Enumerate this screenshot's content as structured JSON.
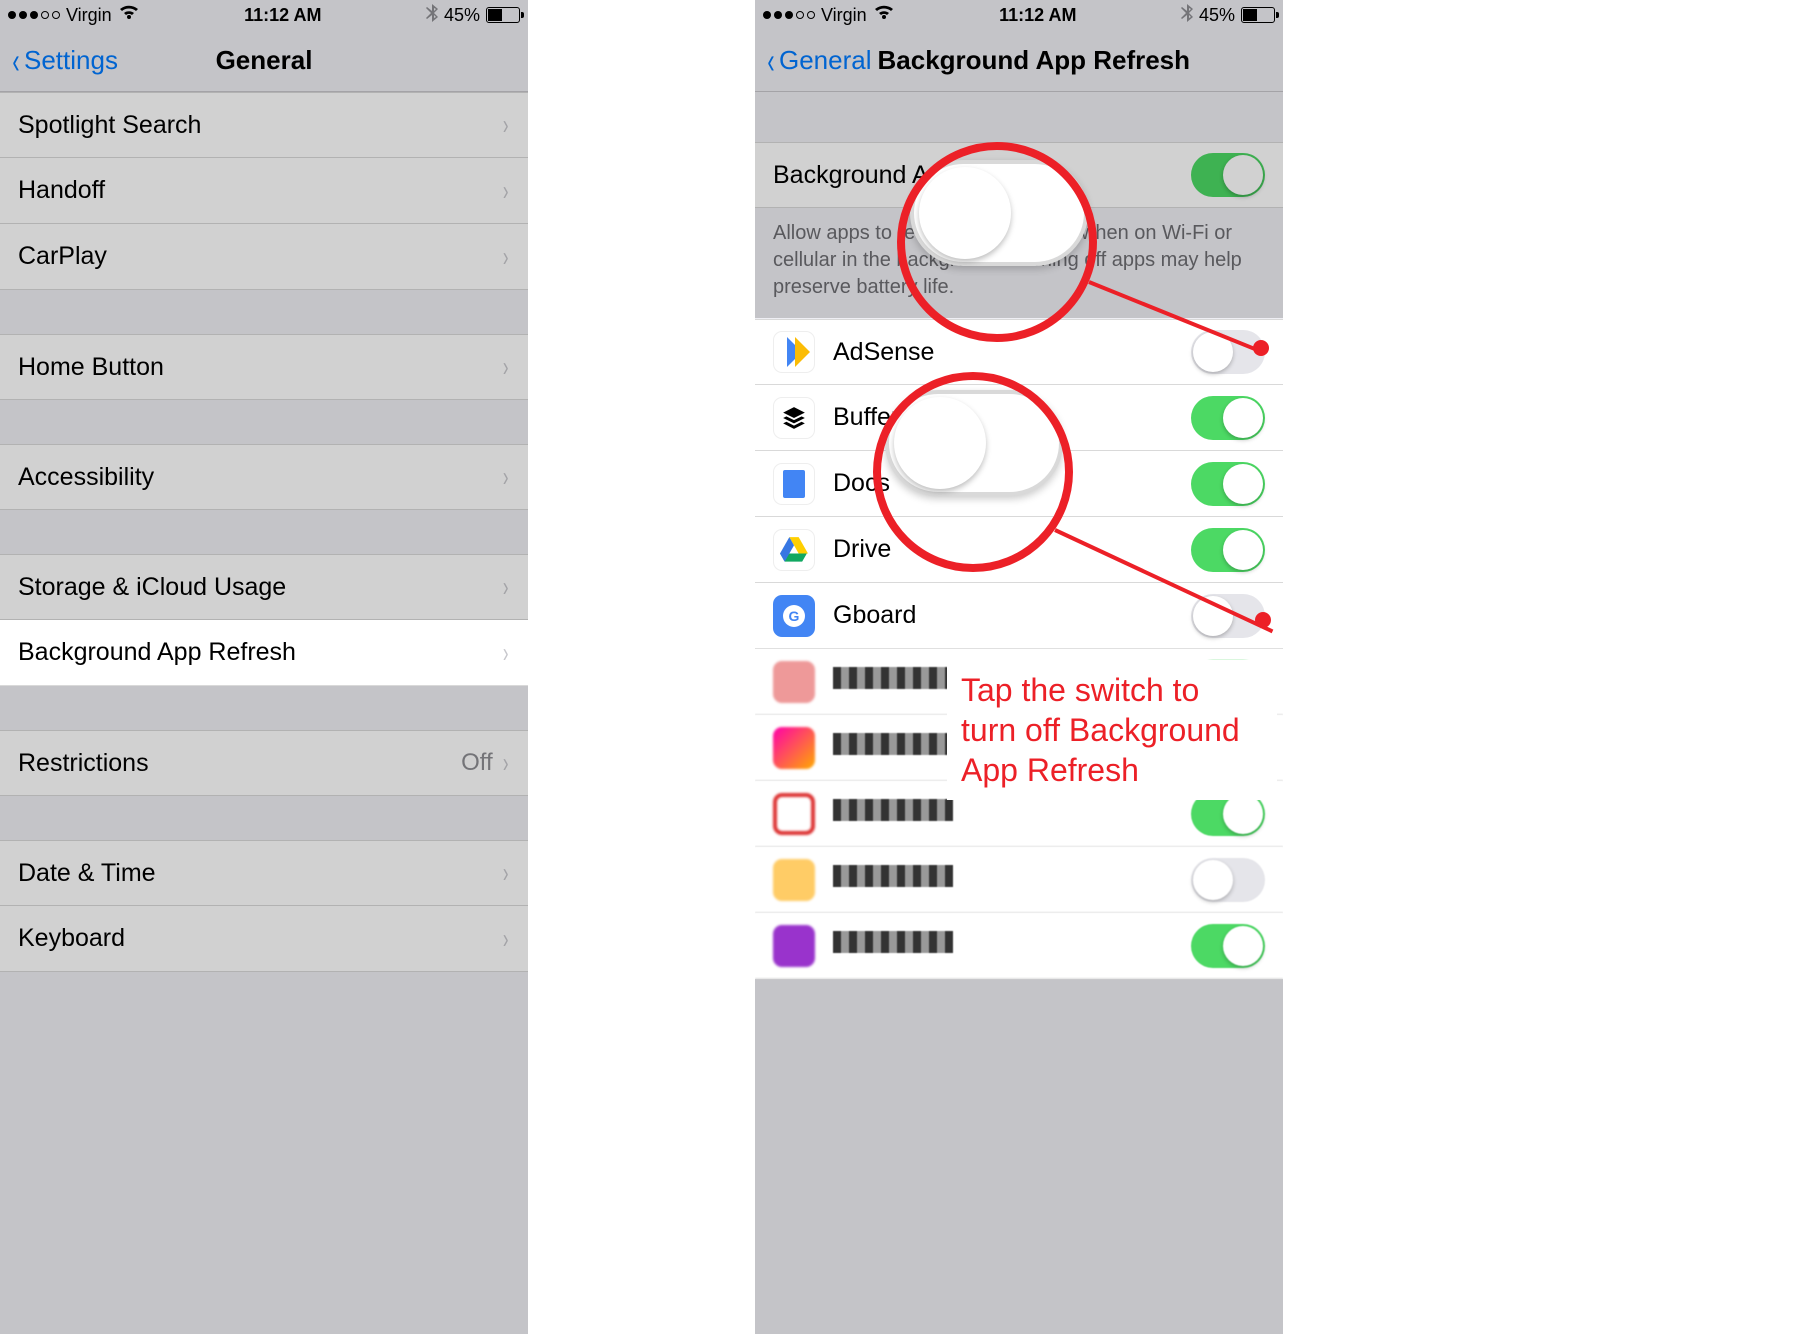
{
  "status": {
    "carrier": "Virgin",
    "time": "11:12 AM",
    "battery_pct": "45%"
  },
  "left": {
    "back": "Settings",
    "title": "General",
    "rows": {
      "spotlight": "Spotlight Search",
      "handoff": "Handoff",
      "carplay": "CarPlay",
      "homebutton": "Home Button",
      "accessibility": "Accessibility",
      "storage": "Storage & iCloud Usage",
      "bgrefresh": "Background App Refresh",
      "restrictions": "Restrictions",
      "restrictions_value": "Off",
      "datetime": "Date & Time",
      "keyboard": "Keyboard"
    }
  },
  "right": {
    "back": "General",
    "title": "Background App Refresh",
    "master_label": "Background App Refresh",
    "master_hint": "Allow apps to refresh their content when on Wi-Fi or cellular in the background. Turning off apps may help preserve battery life.",
    "apps": {
      "adsense": "AdSense",
      "buffer": "Buffer",
      "docs": "Docs",
      "drive": "Drive",
      "gboard": "Gboard"
    }
  },
  "annotation": {
    "callout": "Tap the switch to turn off Background App Refresh"
  }
}
